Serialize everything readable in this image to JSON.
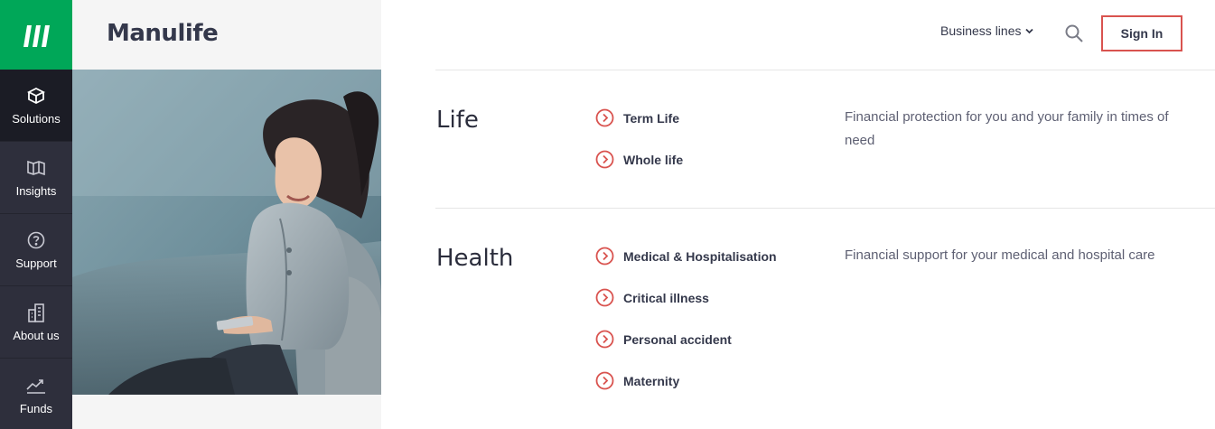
{
  "brand": {
    "name": "Manulife"
  },
  "nav": {
    "items": [
      {
        "label": "Solutions",
        "icon": "box-icon",
        "active": true
      },
      {
        "label": "Insights",
        "icon": "book-icon",
        "active": false
      },
      {
        "label": "Support",
        "icon": "question-circle-icon",
        "active": false
      },
      {
        "label": "About us",
        "icon": "building-icon",
        "active": false
      },
      {
        "label": "Funds",
        "icon": "trend-chart-icon",
        "active": false
      }
    ]
  },
  "header": {
    "business_lines_label": "Business lines",
    "sign_in_label": "Sign In"
  },
  "sections": [
    {
      "title": "Life",
      "description": "Financial protection for you and your family in times of need",
      "links": [
        "Term Life",
        "Whole life"
      ]
    },
    {
      "title": "Health",
      "description": "Financial support for your medical and hospital care",
      "links": [
        "Medical & Hospitalisation",
        "Critical illness",
        "Personal accident",
        "Maternity"
      ]
    }
  ],
  "colors": {
    "brand_green": "#00a758",
    "rail_dark": "#2e2f3c",
    "accent_coral": "#d9534f",
    "text_dark": "#34384b"
  }
}
